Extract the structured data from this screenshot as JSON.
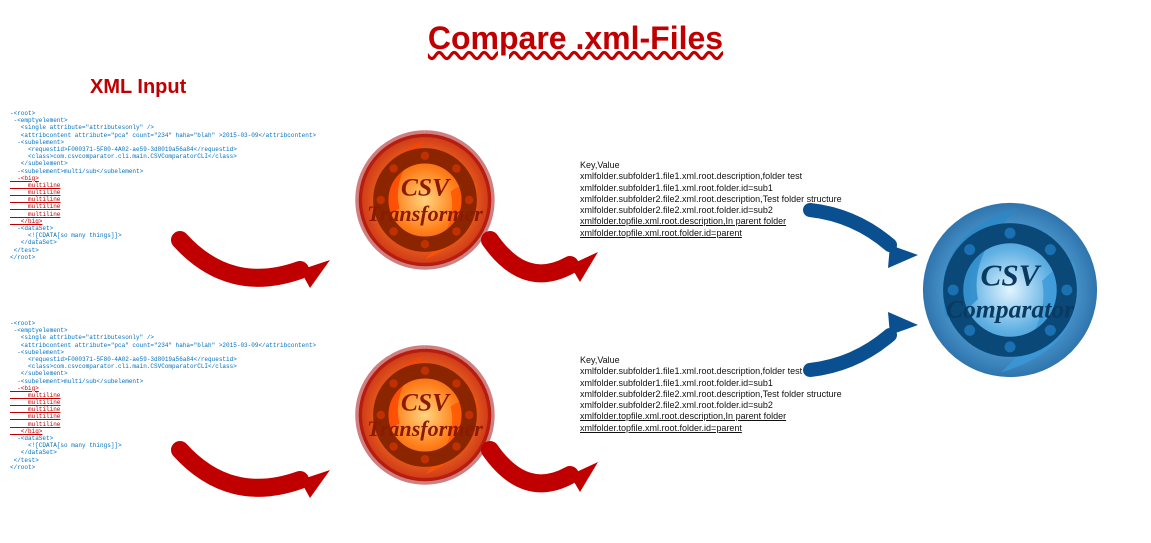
{
  "title": "Compare .xml-Files",
  "section_title": "XML Input",
  "transformer_label1": "CSV",
  "transformer_label2": "Transformer",
  "comparator_label1": "CSV",
  "comparator_label2": "Comparator",
  "xml_input": {
    "lines": [
      "-<root>",
      " -<emptyelement>",
      "   <single attribute=\"attributesonly\" />",
      "   <attribcontent attribute=\"pca\" count=\"234\" haha=\"blah\" >2015-03-09</attribcontent>",
      "  -<subelement>",
      "     <requestid>F000371-5F80-4A02-ae59-3d8019a56a84</requestid>",
      "     <class>com.csvcomparator.cli.main.CSVComparatorCLI</class>",
      "   </subelement>",
      "  -<subelement>multi/sub</subelement>",
      "  -<big>",
      "     multiline",
      "     multiline",
      "     multiline",
      "     multiline",
      "     multiline",
      "   </big>",
      "  -<dataSet>",
      "     <![CDATA[so many things]]>",
      "   </dataSet>",
      " </test>",
      "</root>"
    ]
  },
  "csv_output": {
    "header": "Key,Value",
    "rows": [
      "xmlfolder.subfolder1.file1.xml.root.description,folder test",
      "xmlfolder.subfolder1.file1.xml.root.folder.id=sub1",
      "xmlfolder.subfolder2.file2.xml.root.description,Test folder structure",
      "xmlfolder.subfolder2.file2.xml.root.folder.id=sub2",
      "xmlfolder.topfile.xml.root.description,In parent folder",
      "xmlfolder.topfile.xml.root.folder.id=parent"
    ]
  }
}
